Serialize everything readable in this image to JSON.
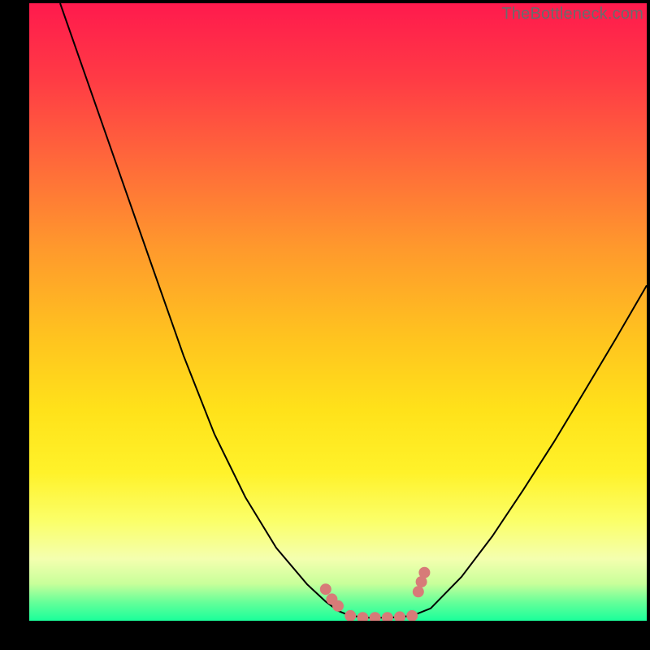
{
  "watermark": "TheBottleneck.com",
  "colors": {
    "frame": "#000000",
    "curve": "#000000",
    "marker": "#d77b78",
    "gradient_top": "#ff1a4d",
    "gradient_mid": "#ffe21a",
    "gradient_bottom": "#1aff9a"
  },
  "chart_data": {
    "type": "line",
    "title": "",
    "xlabel": "",
    "ylabel": "",
    "xlim": [
      0,
      100
    ],
    "ylim": [
      0,
      100
    ],
    "grid": false,
    "legend": false,
    "series": [
      {
        "name": "left-branch",
        "x": [
          5,
          10,
          15,
          20,
          25,
          30,
          35,
          40,
          45,
          48,
          50,
          52
        ],
        "values": [
          100,
          85.7,
          71.4,
          57.1,
          42.9,
          30.2,
          20.0,
          11.8,
          5.9,
          3.1,
          1.6,
          0.8
        ]
      },
      {
        "name": "valley-floor",
        "x": [
          52,
          55,
          58,
          60,
          62
        ],
        "values": [
          0.8,
          0.5,
          0.5,
          0.6,
          0.8
        ]
      },
      {
        "name": "right-branch",
        "x": [
          62,
          65,
          70,
          75,
          80,
          85,
          90,
          95,
          100
        ],
        "values": [
          0.8,
          2.0,
          7.1,
          13.7,
          21.2,
          29.0,
          37.3,
          45.7,
          54.3
        ]
      }
    ],
    "markers": {
      "name": "valley-markers",
      "shape": "circle",
      "color": "#d77b78",
      "points": [
        {
          "x": 48,
          "y": 5.1
        },
        {
          "x": 49,
          "y": 3.5
        },
        {
          "x": 50,
          "y": 2.4
        },
        {
          "x": 52,
          "y": 0.8
        },
        {
          "x": 54,
          "y": 0.5
        },
        {
          "x": 56,
          "y": 0.5
        },
        {
          "x": 58,
          "y": 0.5
        },
        {
          "x": 60,
          "y": 0.6
        },
        {
          "x": 62,
          "y": 0.8
        },
        {
          "x": 63,
          "y": 4.7
        },
        {
          "x": 63.5,
          "y": 6.3
        },
        {
          "x": 64,
          "y": 7.8
        }
      ]
    }
  }
}
